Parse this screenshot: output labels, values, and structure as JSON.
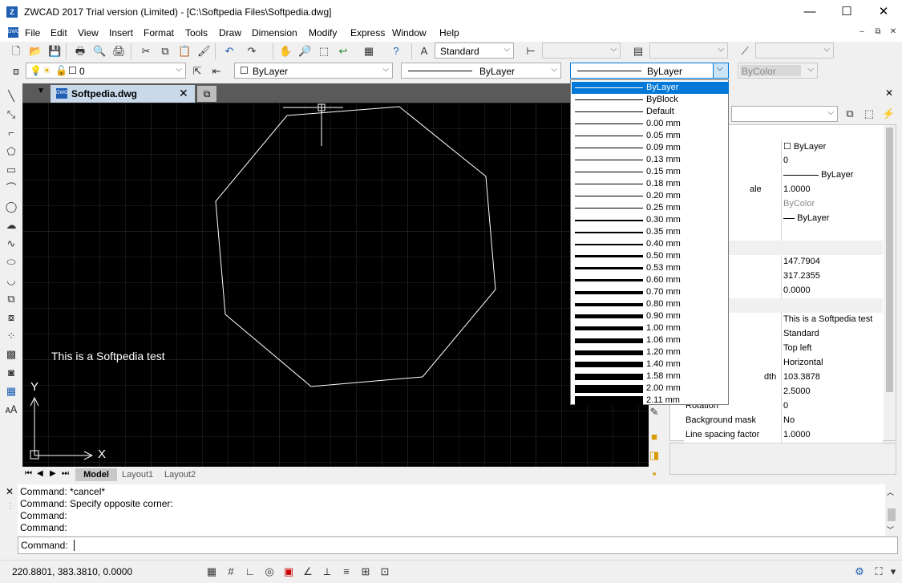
{
  "window": {
    "title": "ZWCAD 2017 Trial version (Limited) - [C:\\Softpedia Files\\Softpedia.dwg]",
    "minimize": "—",
    "maximize": "☐",
    "close": "✕"
  },
  "menu": {
    "items": [
      "File",
      "Edit",
      "View",
      "Insert",
      "Format",
      "Tools",
      "Draw",
      "Dimension",
      "Modify",
      "Express",
      "Window",
      "Help"
    ],
    "doc_min": "‒",
    "doc_restore": "⧉",
    "doc_close": "✕"
  },
  "toolbar": {
    "text_style": "Standard",
    "layer_value": "0",
    "color_value": "ByLayer",
    "linetype_value": "ByLayer",
    "lineweight_value": "ByLayer",
    "plotstyle_value": "ByColor"
  },
  "tabs": {
    "doc_tab": "Softpedia.dwg"
  },
  "canvas": {
    "text": "This is a Softpedia test",
    "ucs_x": "X",
    "ucs_y": "Y"
  },
  "layout_tabs": [
    "Model",
    "Layout1",
    "Layout2"
  ],
  "command": {
    "history": [
      "Command: *cancel*",
      "Command: Specify opposite corner:",
      "Command:",
      "Command:"
    ],
    "prompt": "Command:"
  },
  "status": {
    "coords": "220.8801, 383.3810, 0.0000"
  },
  "lineweight_dropdown": {
    "selected_index": 0,
    "options": [
      {
        "label": "ByLayer",
        "weight": 1
      },
      {
        "label": "ByBlock",
        "weight": 1
      },
      {
        "label": "Default",
        "weight": 1
      },
      {
        "label": "0.00 mm",
        "weight": 1
      },
      {
        "label": "0.05 mm",
        "weight": 1
      },
      {
        "label": "0.09 mm",
        "weight": 1
      },
      {
        "label": "0.13 mm",
        "weight": 1
      },
      {
        "label": "0.15 mm",
        "weight": 1
      },
      {
        "label": "0.18 mm",
        "weight": 1
      },
      {
        "label": "0.20 mm",
        "weight": 1
      },
      {
        "label": "0.25 mm",
        "weight": 1
      },
      {
        "label": "0.30 mm",
        "weight": 2
      },
      {
        "label": "0.35 mm",
        "weight": 2
      },
      {
        "label": "0.40 mm",
        "weight": 2
      },
      {
        "label": "0.50 mm",
        "weight": 3
      },
      {
        "label": "0.53 mm",
        "weight": 3
      },
      {
        "label": "0.60 mm",
        "weight": 3
      },
      {
        "label": "0.70 mm",
        "weight": 4
      },
      {
        "label": "0.80 mm",
        "weight": 4
      },
      {
        "label": "0.90 mm",
        "weight": 5
      },
      {
        "label": "1.00 mm",
        "weight": 5
      },
      {
        "label": "1.06 mm",
        "weight": 6
      },
      {
        "label": "1.20 mm",
        "weight": 6
      },
      {
        "label": "1.40 mm",
        "weight": 7
      },
      {
        "label": "1.58 mm",
        "weight": 8
      },
      {
        "label": "2.00 mm",
        "weight": 10
      },
      {
        "label": "2.11 mm",
        "weight": 11
      }
    ]
  },
  "properties": {
    "rows": [
      {
        "label": "",
        "value": "ByLayer"
      },
      {
        "label": "",
        "value": "0"
      },
      {
        "label": "",
        "value": "ByLayer"
      },
      {
        "label": "ale",
        "value": "1.0000"
      },
      {
        "label": "",
        "value": "ByColor"
      },
      {
        "label": "",
        "value": "ByLayer"
      },
      {
        "label": "",
        "value": ""
      },
      {
        "label": "",
        "value": ""
      },
      {
        "label": "",
        "value": "147.7904"
      },
      {
        "label": "",
        "value": "317.2355"
      },
      {
        "label": "",
        "value": "0.0000"
      },
      {
        "label": "",
        "value": ""
      },
      {
        "label": "",
        "value": "This is a Softpedia test"
      },
      {
        "label": "",
        "value": "Standard"
      },
      {
        "label": "",
        "value": "Top left"
      },
      {
        "label": "",
        "value": "Horizontal"
      },
      {
        "label": "dth",
        "value": "103.3878"
      },
      {
        "label": "",
        "value": "2.5000"
      },
      {
        "label": "Rotation",
        "value": "0"
      },
      {
        "label": "Background mask",
        "value": "No"
      },
      {
        "label": "Line spacing factor",
        "value": "1.0000"
      }
    ]
  }
}
